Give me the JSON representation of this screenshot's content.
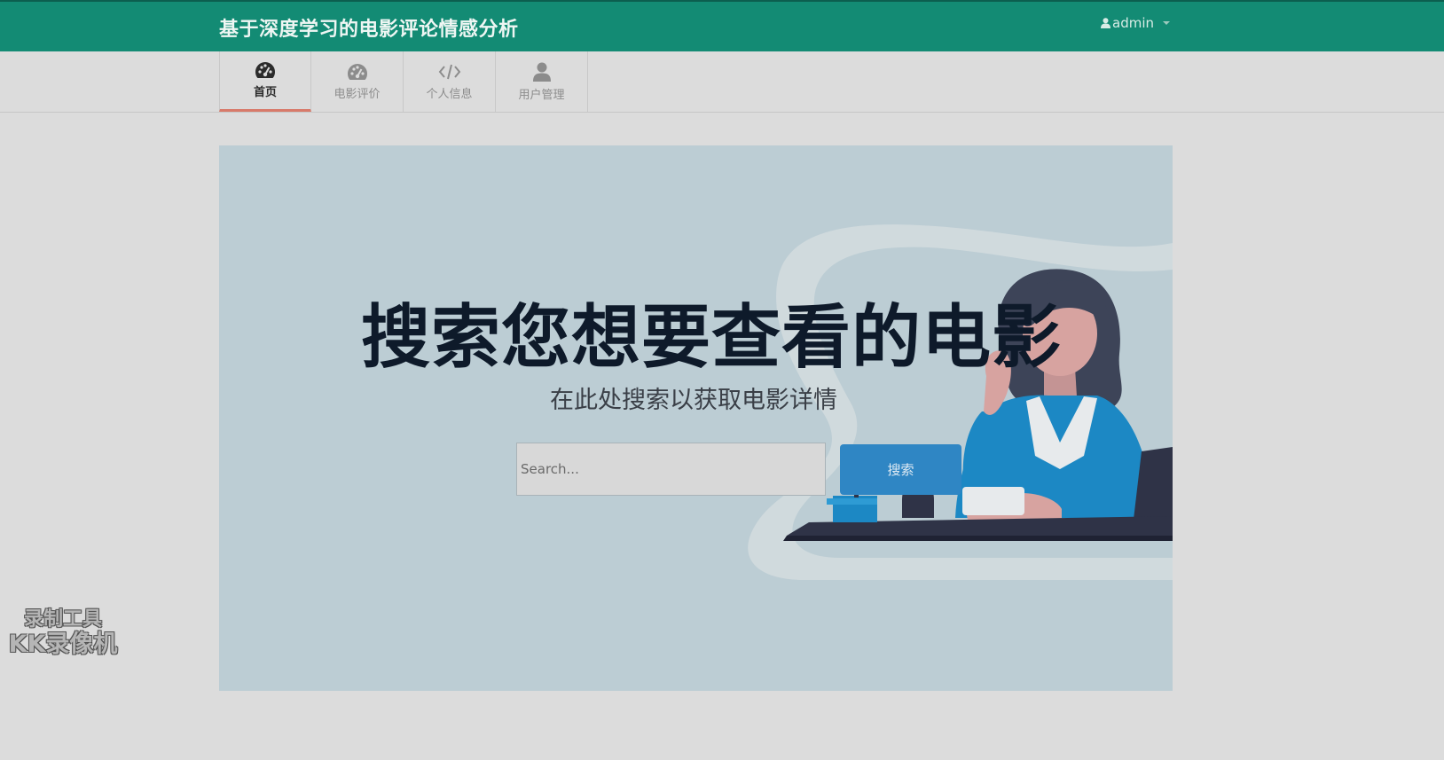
{
  "header": {
    "title": "基于深度学习的电影评论情感分析",
    "user": "admin"
  },
  "nav": {
    "items": [
      {
        "label": "首页",
        "icon": "dashboard-icon",
        "active": true
      },
      {
        "label": "电影评价",
        "icon": "dashboard-icon",
        "active": false
      },
      {
        "label": "个人信息",
        "icon": "code-icon",
        "active": false
      },
      {
        "label": "用户管理",
        "icon": "user-icon",
        "active": false
      }
    ]
  },
  "hero": {
    "title": "搜索您想要查看的电影",
    "subtitle": "在此处搜索以获取电影详情",
    "search_placeholder": "Search...",
    "search_button": "搜索"
  },
  "watermark": {
    "line1": "录制工具",
    "line2": "KK录像机"
  },
  "colors": {
    "header_bg": "#138b74",
    "active_tab_underline": "#d87a6a",
    "search_button": "#2f86c4",
    "hero_bg": "#bccdd4"
  }
}
